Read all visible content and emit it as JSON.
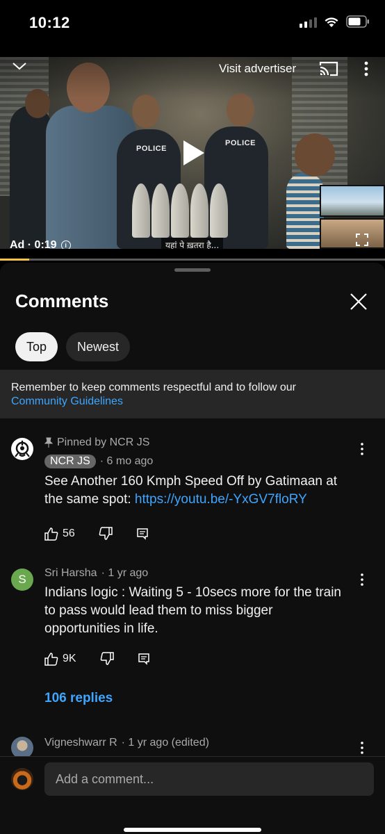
{
  "status": {
    "time": "10:12"
  },
  "video": {
    "visit_advertiser": "Visit advertiser",
    "ad_label": "Ad · 0:19",
    "subtitle": "यहां पे ख़तरा है...",
    "police_label_1": "POLICE",
    "police_label_2": "POLICE",
    "progress_fraction": 0.076,
    "progress_color": "#f6c344"
  },
  "comments_sheet": {
    "title": "Comments",
    "tabs": [
      {
        "label": "Top",
        "active": true
      },
      {
        "label": "Newest",
        "active": false
      }
    ],
    "notice_text": "Remember to keep comments respectful and to follow our",
    "notice_link": "Community Guidelines",
    "comments": [
      {
        "pinned_label": "Pinned by NCR JS",
        "author": "NCR JS",
        "age": "· 6 mo ago",
        "text": "See Another 160 Kmph Speed Off by Gatimaan at the same spot: ",
        "link": "https://youtu.be/-YxGV7floRY",
        "likes": "56",
        "avatar_icon": "ncr-js-logo"
      },
      {
        "author": "Sri Harsha",
        "age": "· 1 yr ago",
        "avatar_letter": "S",
        "avatar_color": "#6aa84f",
        "text": "Indians logic : Waiting 5 - 10secs more for the train to pass would lead them to miss bigger opportunities in life.",
        "likes": "9K",
        "replies": "106 replies"
      },
      {
        "author": "Vigneshwarr R",
        "age": "· 1 yr ago (edited)"
      }
    ],
    "add_comment_placeholder": "Add a comment..."
  },
  "colors": {
    "link": "#3ea6ff",
    "sheet_bg": "#0f0f0f",
    "chip_bg": "#272727"
  }
}
